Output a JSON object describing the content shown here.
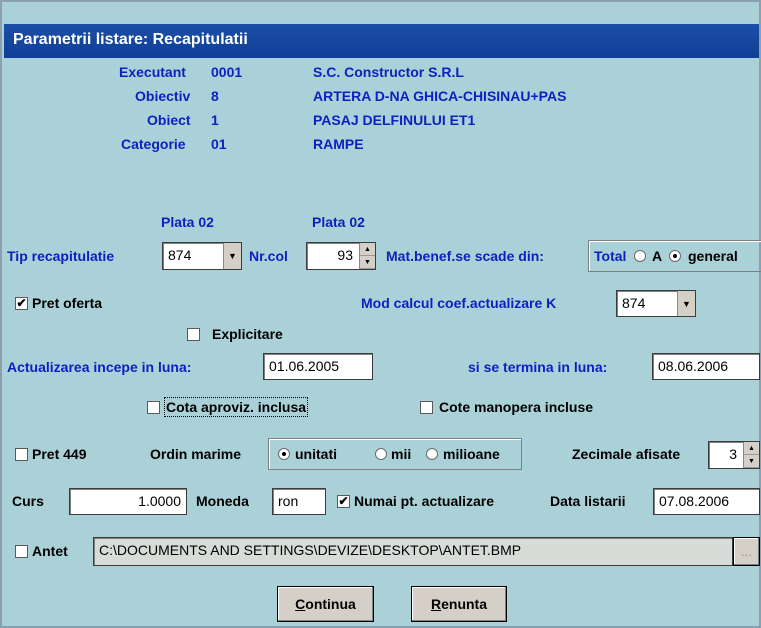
{
  "window": {
    "title": "Parametrii listare: Recapitulatii"
  },
  "header": {
    "rows": [
      {
        "label": "Executant",
        "code": "0001",
        "value": "S.C. Constructor S.R.L"
      },
      {
        "label": "Obiectiv",
        "code": "8",
        "value": "ARTERA D-NA GHICA-CHISINAU+PAS"
      },
      {
        "label": "Obiect",
        "code": "1",
        "value": "PASAJ DELFINULUI ET1"
      },
      {
        "label": "Categorie",
        "code": "01",
        "value": "RAMPE"
      }
    ],
    "plata_left": "Plata 02",
    "plata_right": "Plata 02"
  },
  "form": {
    "tip_recapitulatie_label": "Tip recapitulatie",
    "tip_recapitulatie_value": "874",
    "nr_col_label": "Nr.col",
    "nr_col_value": "93",
    "mat_benef_label": "Mat.benef.se scade din:",
    "mat_benef_group_label": "Total",
    "mat_benef_options": [
      "A",
      "general"
    ],
    "mat_benef_selected": "general",
    "pret_oferta_label": "Pret oferta",
    "pret_oferta_checked": true,
    "mod_calcul_label": "Mod calcul coef.actualizare K",
    "mod_calcul_value": "874",
    "explicitare_label": "Explicitare",
    "explicitare_checked": false,
    "actualizare_incepe_label": "Actualizarea incepe in luna:",
    "actualizare_incepe_value": "01.06.2005",
    "actualizare_termina_label": "si se termina in luna:",
    "actualizare_termina_value": "08.06.2006",
    "cota_aproviz_label": "Cota aproviz. inclusa",
    "cota_aproviz_checked": false,
    "cote_manopera_label": "Cote manopera incluse",
    "cote_manopera_checked": false,
    "pret449_label": "Pret 449",
    "pret449_checked": false,
    "ordin_marime_label": "Ordin marime",
    "ordin_marime_options": [
      "unitati",
      "mii",
      "milioane"
    ],
    "ordin_marime_selected": "unitati",
    "zecimale_label": "Zecimale afisate",
    "zecimale_value": "3",
    "curs_label": "Curs",
    "curs_value": "1.0000",
    "moneda_label": "Moneda",
    "moneda_value": "ron",
    "numai_actualizare_label": "Numai pt. actualizare",
    "numai_actualizare_checked": true,
    "data_listarii_label": "Data listarii",
    "data_listarii_value": "07.08.2006",
    "antet_label": "Antet",
    "antet_checked": false,
    "antet_path": "C:\\DOCUMENTS AND SETTINGS\\DEVIZE\\DESKTOP\\ANTET.BMP",
    "browse_label": "..."
  },
  "buttons": {
    "continua_accel": "C",
    "continua_rest": "ontinua",
    "renunta_accel": "R",
    "renunta_rest": "enunta"
  },
  "icons": {
    "dropdown": "chevron-down-icon",
    "spin_up": "triangle-up-icon",
    "spin_down": "triangle-down-icon",
    "check": "checkmark-icon"
  }
}
